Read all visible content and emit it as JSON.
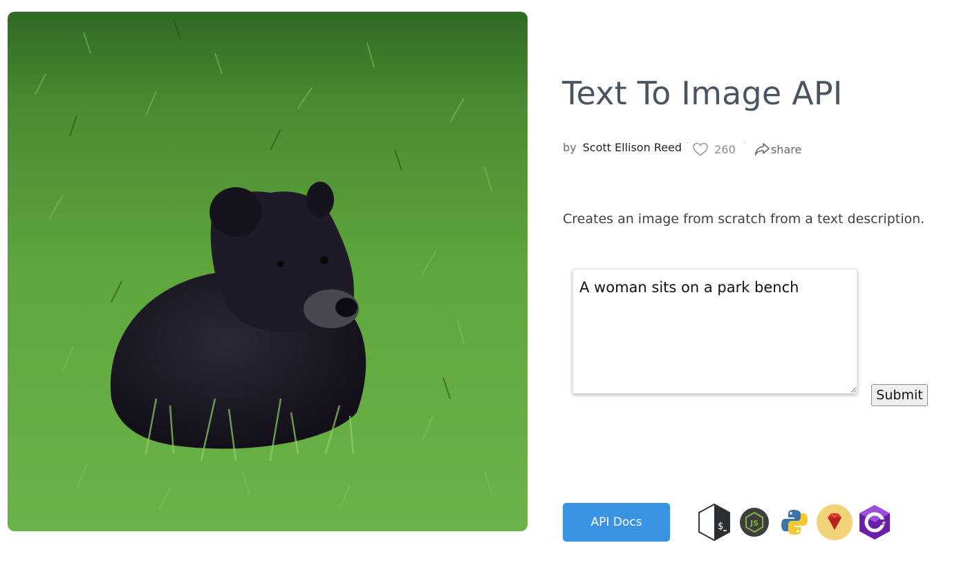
{
  "hero": {
    "image_description_icon": "photo-icon"
  },
  "header": {
    "title": "Text To Image API"
  },
  "meta": {
    "by_label": "by",
    "author": "Scott Ellison Reed",
    "separator": "·",
    "likes_count": "260",
    "share_label": "share",
    "like_icon": "heart-icon",
    "share_icon": "share-arrow-icon"
  },
  "main": {
    "description": "Creates an image from scratch from a text description.",
    "prompt_value": "A woman sits on a park bench",
    "submit_label": "Submit",
    "docs_label": "API Docs"
  },
  "languages": [
    {
      "name": "bash",
      "icon": "bash-icon"
    },
    {
      "name": "node.js",
      "icon": "nodejs-icon"
    },
    {
      "name": "python",
      "icon": "python-icon"
    },
    {
      "name": "ruby",
      "icon": "ruby-icon"
    },
    {
      "name": "csharp",
      "icon": "csharp-icon"
    }
  ],
  "colors": {
    "accent": "#3a92e2",
    "title": "#4a5562"
  }
}
